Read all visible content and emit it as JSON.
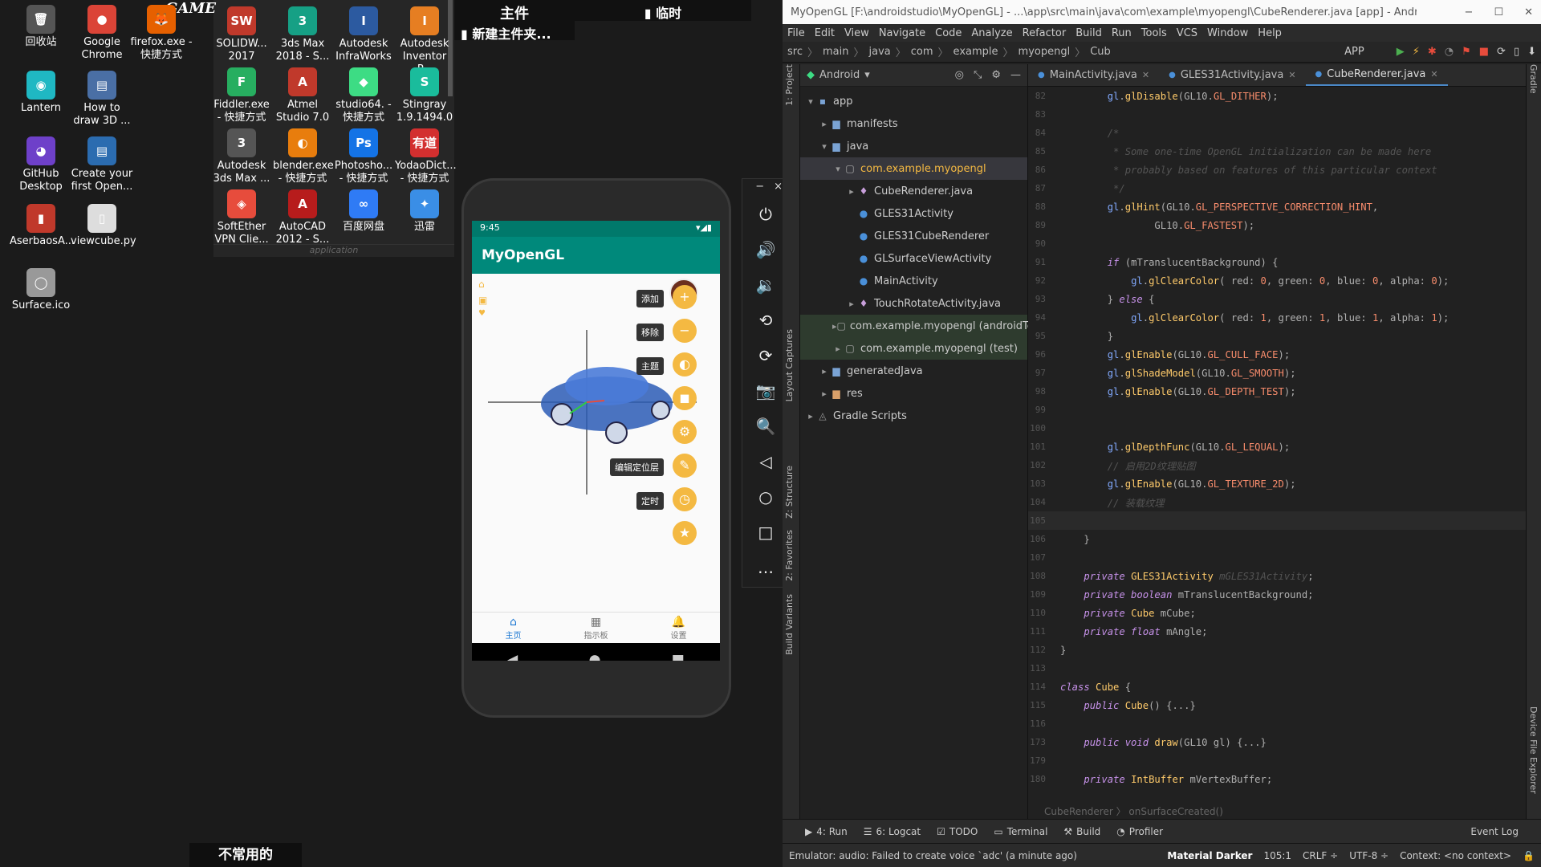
{
  "desktop": {
    "icons": [
      {
        "label": "回收站",
        "glyph": "🗑",
        "color": "#555"
      },
      {
        "label": "Google Chrome",
        "glyph": "●",
        "color": "#db4437"
      },
      {
        "label": "firefox.exe - 快捷方式",
        "glyph": "🦊",
        "color": "#e66000"
      },
      {
        "label": "Lantern",
        "glyph": "◉",
        "color": "#1fb8c3"
      },
      {
        "label": "How to draw 3D ...",
        "glyph": "▤",
        "color": "#4a6fa5"
      },
      {
        "label": "GitHub Desktop",
        "glyph": "◕",
        "color": "#6e40c9"
      },
      {
        "label": "Create your first Open...",
        "glyph": "▤",
        "color": "#2b6cb0"
      },
      {
        "label": "AserbaosA...",
        "glyph": "▮",
        "color": "#c0392b"
      },
      {
        "label": "viewcube.py",
        "glyph": "▯",
        "color": "#ddd"
      },
      {
        "label": "Surface.ico",
        "glyph": "◯",
        "color": "#999"
      }
    ],
    "fence_icons": [
      {
        "label": "SOLIDW... 2017",
        "glyph": "SW",
        "color": "#c0392b"
      },
      {
        "label": "3ds Max 2018 - S...",
        "glyph": "3",
        "color": "#16a085"
      },
      {
        "label": "Autodesk InfraWorks",
        "glyph": "I",
        "color": "#2c5aa0"
      },
      {
        "label": "Autodesk Inventor P...",
        "glyph": "I",
        "color": "#e67e22"
      },
      {
        "label": "Fiddler.exe - 快捷方式",
        "glyph": "F",
        "color": "#27ae60"
      },
      {
        "label": "Atmel Studio 7.0",
        "glyph": "A",
        "color": "#c0392b"
      },
      {
        "label": "studio64. - 快捷方式",
        "glyph": "◆",
        "color": "#3ddc84"
      },
      {
        "label": "Stingray 1.9.1494.0",
        "glyph": "S",
        "color": "#1abc9c"
      },
      {
        "label": "Autodesk 3ds Max ...",
        "glyph": "3",
        "color": "#555"
      },
      {
        "label": "blender.exe - 快捷方式",
        "glyph": "◐",
        "color": "#e87d0d"
      },
      {
        "label": "Photosho... - 快捷方式",
        "glyph": "Ps",
        "color": "#1473e6"
      },
      {
        "label": "YodaoDict... - 快捷方式",
        "glyph": "有道",
        "color": "#d32f2f"
      },
      {
        "label": "SoftEther VPN Clie...",
        "glyph": "◈",
        "color": "#e74c3c"
      },
      {
        "label": "AutoCAD 2012 - S...",
        "glyph": "A",
        "color": "#b71c1c"
      },
      {
        "label": "百度网盘",
        "glyph": "∞",
        "color": "#2f7bf5"
      },
      {
        "label": "迅雷",
        "glyph": "✦",
        "color": "#3a8ee6"
      }
    ],
    "fence_top_label": "GAME",
    "fence_bottom_label": "application",
    "fence2_title": "主件",
    "fence2_item": "新建主件夹...",
    "fence3_title": "临时",
    "taskbar_label": "不常用的"
  },
  "emulator": {
    "time": "9:45",
    "app_title": "MyOpenGL",
    "fab_labels": [
      "添加",
      "移除",
      "主题",
      "编辑定位层",
      "定时"
    ],
    "fab_glyphs": [
      "+",
      "−",
      "◐",
      "◼",
      "⚙",
      "✎",
      "◷",
      "★"
    ],
    "nav_tabs": [
      {
        "label": "主页",
        "glyph": "⌂"
      },
      {
        "label": "指示板",
        "glyph": "▦"
      },
      {
        "label": "设置",
        "glyph": "🔔"
      }
    ],
    "side_tools": [
      "⏻",
      "🔊",
      "🔉",
      "⟲",
      "⟳",
      "📷",
      "🔍",
      "◁",
      "○",
      "□",
      "…"
    ],
    "toolbar_window_controls": [
      "−",
      "×"
    ]
  },
  "ide": {
    "title": "MyOpenGL [F:\\androidstudio\\MyOpenGL] - ...\\app\\src\\main\\java\\com\\example\\myopengl\\CubeRenderer.java [app] - Android Studio ...",
    "menu": [
      "File",
      "Edit",
      "View",
      "Navigate",
      "Code",
      "Analyze",
      "Refactor",
      "Build",
      "Run",
      "Tools",
      "VCS",
      "Window",
      "Help"
    ],
    "breadcrumbs": [
      "src",
      "main",
      "java",
      "com",
      "example",
      "myopengl",
      "Cub"
    ],
    "run_config": "APP",
    "project_header": "Android",
    "left_labels": [
      "1: Project",
      "Layout Captures",
      "Z: Structure",
      "2: Favorites",
      "Build Variants"
    ],
    "right_labels": [
      "Gradle",
      "Device File Explorer"
    ],
    "tree": [
      {
        "label": "app",
        "depth": 0,
        "arrow": "▾",
        "icon": "▪",
        "iconColor": "#7aa3d4",
        "state": ""
      },
      {
        "label": "manifests",
        "depth": 1,
        "arrow": "▸",
        "icon": "▆",
        "iconColor": "#7aa3d4",
        "state": ""
      },
      {
        "label": "java",
        "depth": 1,
        "arrow": "▾",
        "icon": "▆",
        "iconColor": "#7aa3d4",
        "state": ""
      },
      {
        "label": "com.example.myopengl",
        "depth": 2,
        "arrow": "▾",
        "icon": "▢",
        "iconColor": "#aaa",
        "state": "sel"
      },
      {
        "label": "CubeRenderer.java",
        "depth": 3,
        "arrow": "▸",
        "icon": "♦",
        "iconColor": "#c9a0dc",
        "state": ""
      },
      {
        "label": "GLES31Activity",
        "depth": 3,
        "arrow": "",
        "icon": "●",
        "iconColor": "#4a90d9",
        "state": ""
      },
      {
        "label": "GLES31CubeRenderer",
        "depth": 3,
        "arrow": "",
        "icon": "●",
        "iconColor": "#4a90d9",
        "state": ""
      },
      {
        "label": "GLSurfaceViewActivity",
        "depth": 3,
        "arrow": "",
        "icon": "●",
        "iconColor": "#4a90d9",
        "state": ""
      },
      {
        "label": "MainActivity",
        "depth": 3,
        "arrow": "",
        "icon": "●",
        "iconColor": "#4a90d9",
        "state": ""
      },
      {
        "label": "TouchRotateActivity.java",
        "depth": 3,
        "arrow": "▸",
        "icon": "♦",
        "iconColor": "#c9a0dc",
        "state": ""
      },
      {
        "label": "com.example.myopengl (androidTest)",
        "depth": 2,
        "arrow": "▸",
        "icon": "▢",
        "iconColor": "#aaa",
        "state": "hl"
      },
      {
        "label": "com.example.myopengl (test)",
        "depth": 2,
        "arrow": "▸",
        "icon": "▢",
        "iconColor": "#aaa",
        "state": "hl"
      },
      {
        "label": "generatedJava",
        "depth": 1,
        "arrow": "▸",
        "icon": "▆",
        "iconColor": "#7aa3d4",
        "state": ""
      },
      {
        "label": "res",
        "depth": 1,
        "arrow": "▸",
        "icon": "▆",
        "iconColor": "#d9a06a",
        "state": ""
      },
      {
        "label": "Gradle Scripts",
        "depth": 0,
        "arrow": "▸",
        "icon": "◬",
        "iconColor": "#999",
        "state": ""
      }
    ],
    "tabs": [
      {
        "label": "MainActivity.java",
        "active": false
      },
      {
        "label": "GLES31Activity.java",
        "active": false
      },
      {
        "label": "CubeRenderer.java",
        "active": true
      }
    ],
    "code_lines": [
      {
        "n": "82",
        "html": "        <span class='v'>gl</span>.<span class='f'>glDisable</span>(GL10.<span class='n'>GL_DITHER</span>);"
      },
      {
        "n": "83",
        "html": ""
      },
      {
        "n": "84",
        "html": "        <span class='c'>/*</span>"
      },
      {
        "n": "85",
        "html": "        <span class='c'> * Some one-time OpenGL initialization can be made here</span>"
      },
      {
        "n": "86",
        "html": "        <span class='c'> * probably based on features of this particular context</span>"
      },
      {
        "n": "87",
        "html": "        <span class='c'> */</span>"
      },
      {
        "n": "88",
        "html": "        <span class='v'>gl</span>.<span class='f'>glHint</span>(GL10.<span class='n'>GL_PERSPECTIVE_CORRECTION_HINT</span>,"
      },
      {
        "n": "89",
        "html": "                GL10.<span class='n'>GL_FASTEST</span>);"
      },
      {
        "n": "90",
        "html": ""
      },
      {
        "n": "91",
        "html": "        <span class='k'>if</span> (mTranslucentBackground) {"
      },
      {
        "n": "92",
        "html": "            <span class='v'>gl</span>.<span class='f'>glClearColor</span>( red: <span class='n'>0</span>, green: <span class='n'>0</span>, blue: <span class='n'>0</span>, alpha: <span class='n'>0</span>);"
      },
      {
        "n": "93",
        "html": "        } <span class='k'>else</span> {"
      },
      {
        "n": "94",
        "html": "            <span class='v'>gl</span>.<span class='f'>glClearColor</span>( red: <span class='n'>1</span>, green: <span class='n'>1</span>, blue: <span class='n'>1</span>, alpha: <span class='n'>1</span>);"
      },
      {
        "n": "95",
        "html": "        }"
      },
      {
        "n": "96",
        "html": "        <span class='v'>gl</span>.<span class='f'>glEnable</span>(GL10.<span class='n'>GL_CULL_FACE</span>);"
      },
      {
        "n": "97",
        "html": "        <span class='v'>gl</span>.<span class='f'>glShadeModel</span>(GL10.<span class='n'>GL_SMOOTH</span>);"
      },
      {
        "n": "98",
        "html": "        <span class='v'>gl</span>.<span class='f'>glEnable</span>(GL10.<span class='n'>GL_DEPTH_TEST</span>);"
      },
      {
        "n": "99",
        "html": ""
      },
      {
        "n": "100",
        "html": ""
      },
      {
        "n": "101",
        "html": "        <span class='v'>gl</span>.<span class='f'>glDepthFunc</span>(GL10.<span class='n'>GL_LEQUAL</span>);"
      },
      {
        "n": "102",
        "html": "        <span class='c'>// 启用2D纹理贴图</span>"
      },
      {
        "n": "103",
        "html": "        <span class='v'>gl</span>.<span class='f'>glEnable</span>(GL10.<span class='n'>GL_TEXTURE_2D</span>);"
      },
      {
        "n": "104",
        "html": "        <span class='c'>// 装载纹理</span>"
      },
      {
        "n": "105",
        "html": "",
        "cur": true
      },
      {
        "n": "106",
        "html": "    }"
      },
      {
        "n": "107",
        "html": ""
      },
      {
        "n": "108",
        "html": "    <span class='k'>private</span> <span class='f'>GLES31Activity</span> <span class='c'>mGLES31Activity</span>;"
      },
      {
        "n": "109",
        "html": "    <span class='k'>private boolean</span> mTranslucentBackground;"
      },
      {
        "n": "110",
        "html": "    <span class='k'>private</span> <span class='f'>Cube</span> mCube;"
      },
      {
        "n": "111",
        "html": "    <span class='k'>private float</span> mAngle;"
      },
      {
        "n": "112",
        "html": "}"
      },
      {
        "n": "113",
        "html": ""
      },
      {
        "n": "114",
        "html": "<span class='k'>class</span> <span class='f'>Cube</span> {"
      },
      {
        "n": "115",
        "html": "    <span class='k'>public</span> <span class='f'>Cube</span>() {...}"
      },
      {
        "n": "116",
        "html": ""
      },
      {
        "n": "173",
        "html": "    <span class='k'>public void</span> <span class='f'>draw</span>(GL10 gl) {...}"
      },
      {
        "n": "179",
        "html": ""
      },
      {
        "n": "180",
        "html": "    <span class='k'>private</span> <span class='f'>IntBuffer</span> mVertexBuffer;"
      }
    ],
    "editor_breadcrumb": "CubeRenderer  〉 onSurfaceCreated()",
    "bottom_tools": [
      {
        "glyph": "▶",
        "label": "4: Run"
      },
      {
        "glyph": "☰",
        "label": "6: Logcat"
      },
      {
        "glyph": "☑",
        "label": "TODO"
      },
      {
        "glyph": "▭",
        "label": "Terminal"
      },
      {
        "glyph": "⚒",
        "label": "Build"
      },
      {
        "glyph": "◔",
        "label": "Profiler"
      }
    ],
    "event_log": "Event Log",
    "status_message": "Emulator: audio: Failed to create voice `adc' (a minute ago)",
    "theme": "Material Darker",
    "position": "105:1",
    "line_sep": "CRLF ÷",
    "encoding": "UTF-8 ÷",
    "context": "Context: <no context>"
  }
}
